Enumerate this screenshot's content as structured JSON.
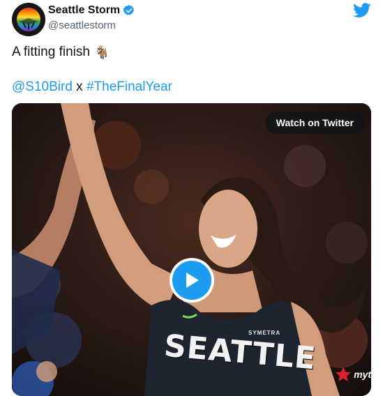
{
  "author": {
    "display_name": "Seattle Storm",
    "handle": "@seattlestorm",
    "verified": true
  },
  "tweet": {
    "text": "A fitting finish",
    "emoji": "🐐",
    "mention": "@S10Bird",
    "separator": "x",
    "hashtag": "#TheFinalYear"
  },
  "media": {
    "watch_label": "Watch on Twitter",
    "jersey_text": "SEATTLE",
    "sponsor_text": "SYMETRA",
    "watermark_text": "myt"
  },
  "colors": {
    "link": "#1d9bf0",
    "twitter_blue": "#1d9bf0",
    "text": "#0f1419",
    "secondary_text": "#536471"
  }
}
